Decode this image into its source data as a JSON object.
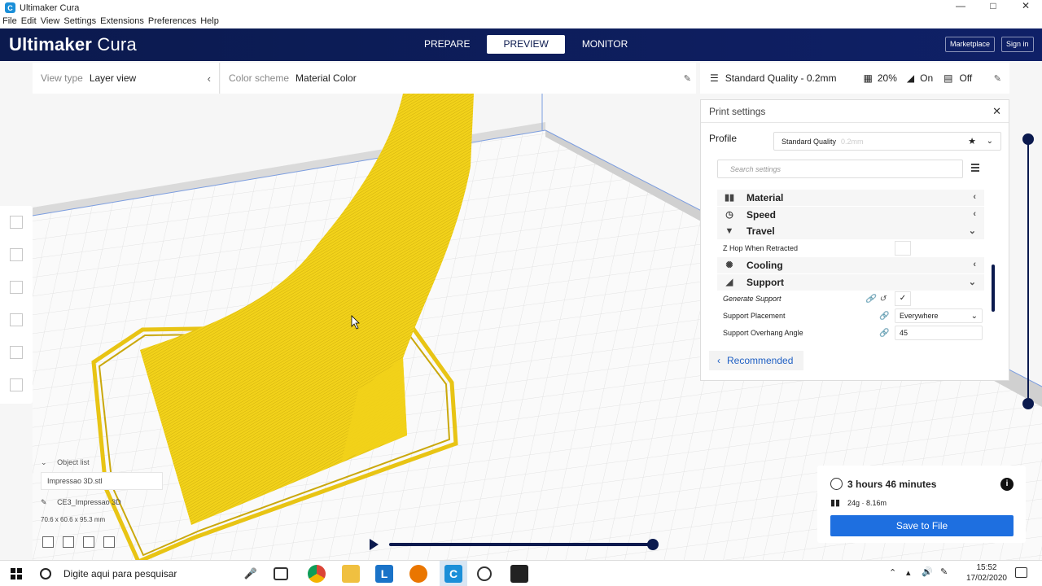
{
  "window": {
    "title": "Ultimaker Cura"
  },
  "menu": [
    "File",
    "Edit",
    "View",
    "Settings",
    "Extensions",
    "Preferences",
    "Help"
  ],
  "brand": {
    "bold": "Ultimaker",
    "light": "Cura"
  },
  "stages": [
    "PREPARE",
    "PREVIEW",
    "MONITOR"
  ],
  "header_buttons": {
    "marketplace": "Marketplace",
    "sign_in": "Sign in"
  },
  "view_type": {
    "label": "View type",
    "value": "Layer view"
  },
  "color_scheme": {
    "label": "Color scheme",
    "value": "Material Color"
  },
  "quality_bar": {
    "profile": "Standard Quality - 0.2mm",
    "infill": "20%",
    "support": "On",
    "adhesion": "Off"
  },
  "print_settings": {
    "title": "Print settings",
    "profile_label": "Profile",
    "profile_value": "Standard Quality",
    "profile_sub": "0.2mm",
    "search_placeholder": "Search settings",
    "categories": {
      "material": "Material",
      "speed": "Speed",
      "travel": "Travel",
      "cooling": "Cooling",
      "support": "Support"
    },
    "settings": {
      "z_hop": "Z Hop When Retracted",
      "generate_support": "Generate Support",
      "support_placement": "Support Placement",
      "support_placement_value": "Everywhere",
      "support_overhang": "Support Overhang Angle",
      "support_overhang_value": "45"
    },
    "recommended": "Recommended"
  },
  "object_list": {
    "label": "Object list",
    "file": "Impressao 3D.stl",
    "name": "CE3_Impressao 3D",
    "dimensions": "70.6 x 60.6 x 95.3 mm"
  },
  "print_info": {
    "time": "3 hours 46 minutes",
    "material": "24g · 8.16m",
    "save": "Save to File"
  },
  "taskbar": {
    "search_placeholder": "Digite aqui para pesquisar",
    "time": "15:52",
    "date": "17/02/2020"
  },
  "colors": {
    "header": "#0b1a4e",
    "accent": "#1e6fe0",
    "model": "#f2d21a"
  }
}
